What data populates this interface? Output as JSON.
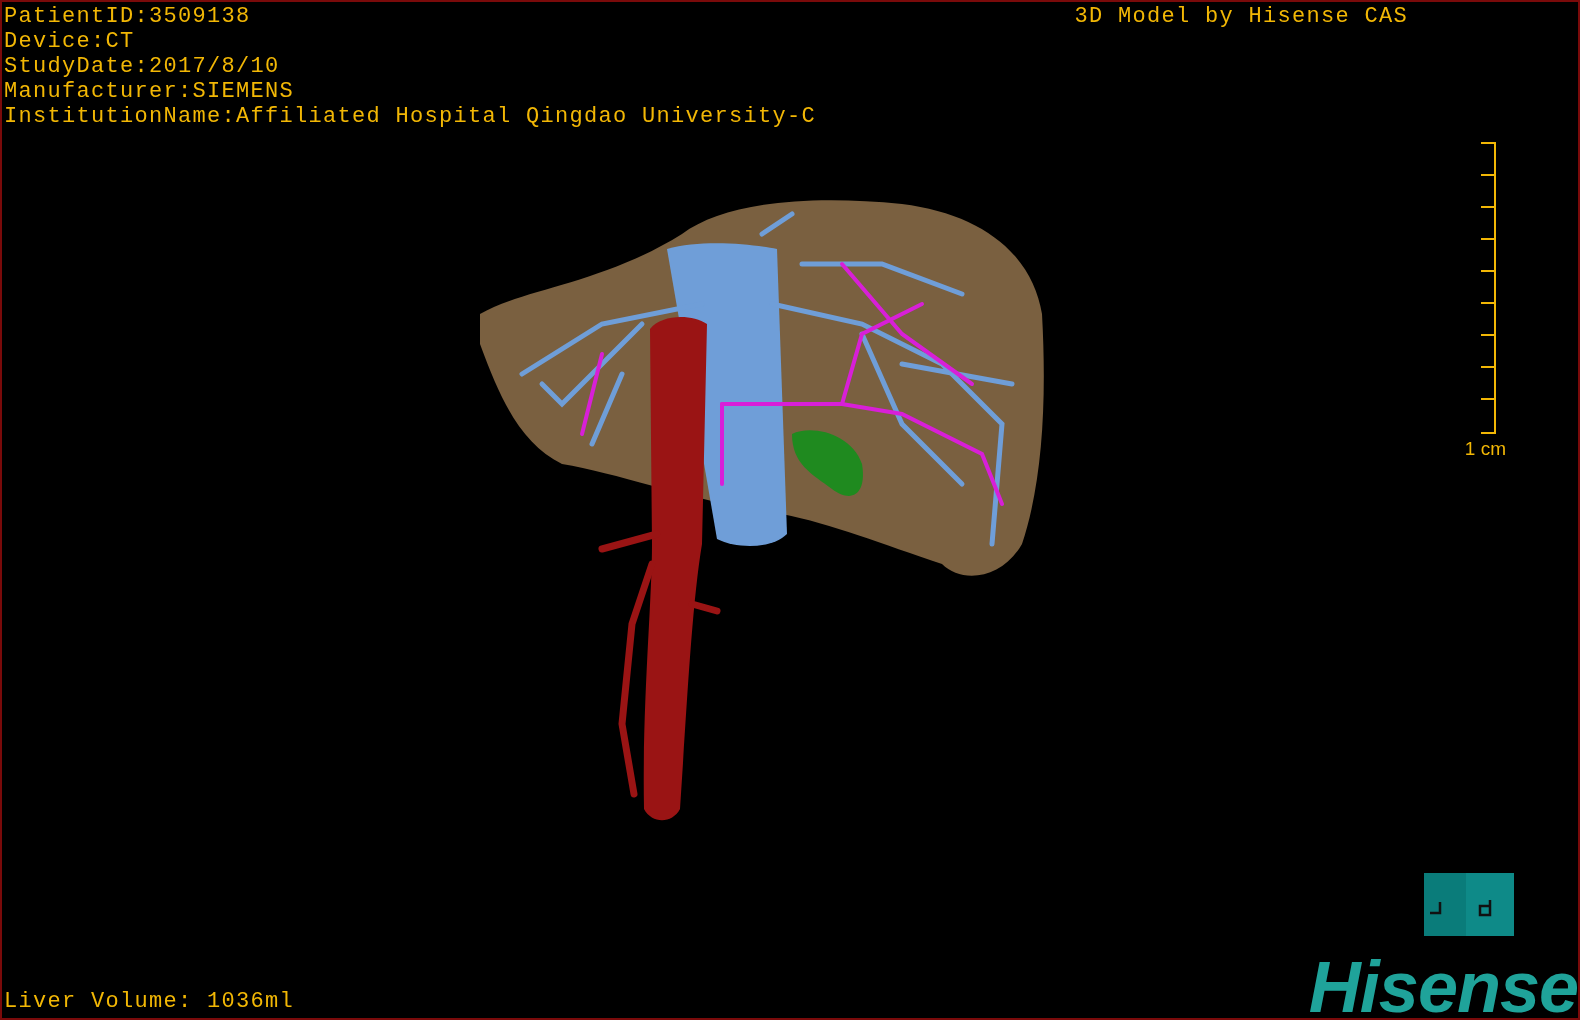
{
  "study_info": [
    "PatientID:3509138",
    "Device:CT",
    "StudyDate:2017/8/10",
    "Manufacturer:SIEMENS",
    "InstitutionName:Affiliated Hospital Qingdao University-C"
  ],
  "title": "3D Model by Hisense CAS",
  "scale_bar": {
    "label": "1 cm"
  },
  "liver_volume": "Liver Volume: 1036ml",
  "logo": "Hisense"
}
